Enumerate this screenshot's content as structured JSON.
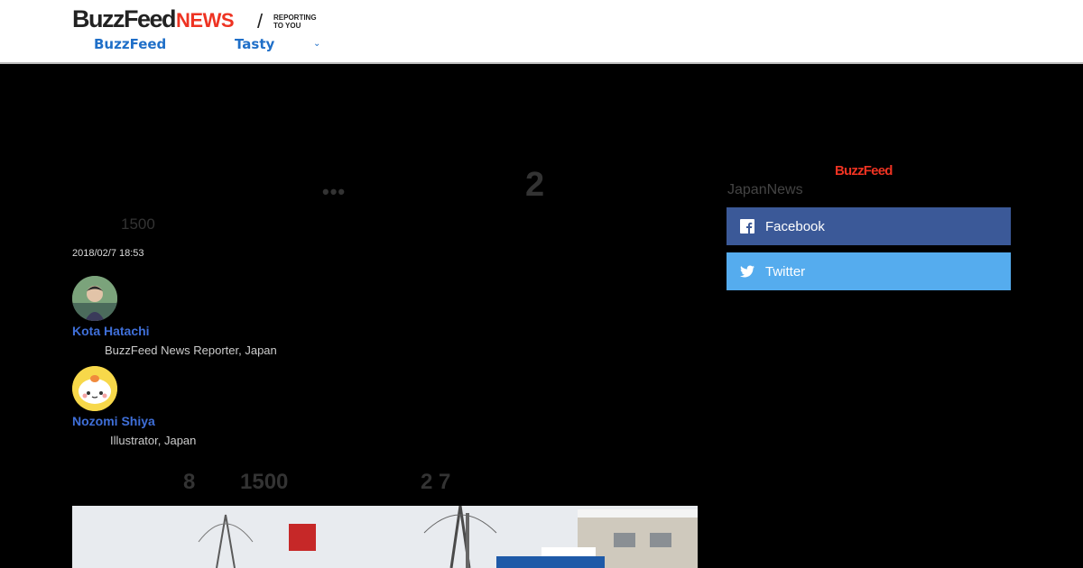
{
  "header": {
    "logo": {
      "buzzfeed": "BuzzFeed",
      "news": "NEWS",
      "tagline_1": "REPORTING",
      "tagline_2": "TO YOU"
    },
    "nav": [
      {
        "label": "BuzzFeed"
      },
      {
        "label": "Tasty"
      }
    ]
  },
  "article": {
    "title_fragment": "2",
    "subtitle_fragment": "1500",
    "date": "2018/02/7 18:53",
    "authors": [
      {
        "name": "Kota Hatachi",
        "role": "BuzzFeed News Reporter, Japan"
      },
      {
        "name": "Nozomi Shiya",
        "role": "Illustrator, Japan"
      }
    ],
    "lead_fragments": [
      "8",
      "1500",
      "2 7"
    ]
  },
  "sidebar": {
    "brand": "BuzzFeed",
    "label": "JapanNews",
    "share": [
      {
        "label": "Facebook",
        "color": "#3b5998"
      },
      {
        "label": "Twitter",
        "color": "#55acee"
      }
    ]
  },
  "colors": {
    "link": "#1f6fc8",
    "author": "#3f6fd8",
    "brand_red": "#ee3322"
  }
}
